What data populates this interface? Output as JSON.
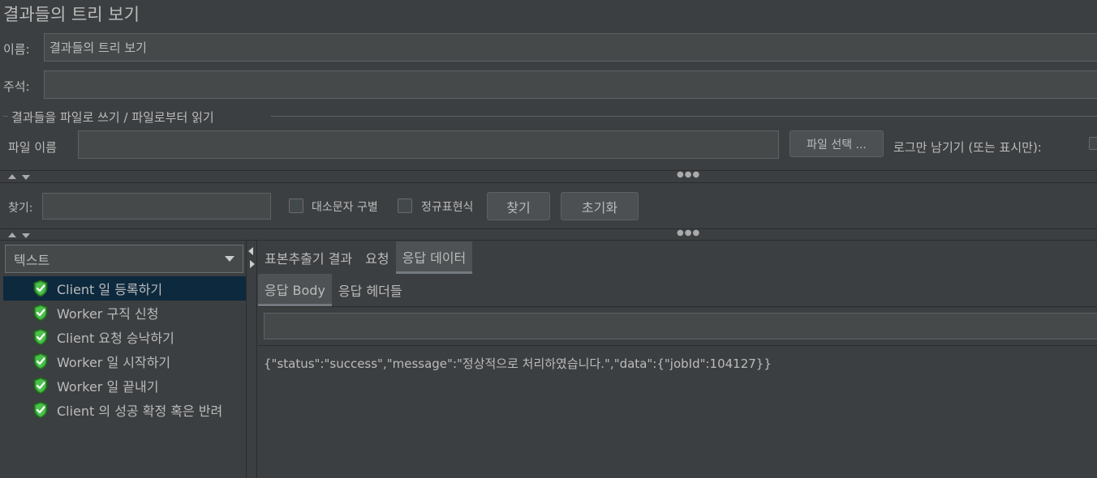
{
  "window": {
    "title": "결과들의 트리 보기"
  },
  "form": {
    "name_label": "이름:",
    "name_value": "결과들의 트리 보기",
    "comment_label": "주석:",
    "comment_value": "",
    "file_group_title": "결과들을 파일로 쓰기 / 파일로부터 읽기",
    "filename_label": "파일 이름",
    "filename_value": "",
    "browse_button": "파일 선택 ...",
    "log_only_label": "로그만 남기기 (또는 표시만):"
  },
  "search": {
    "label": "찾기:",
    "value": "",
    "case_sensitive_label": "대소문자 구별",
    "regex_label": "정규표현식",
    "find_button": "찾기",
    "reset_button": "초기화"
  },
  "renderer": {
    "selected": "텍스트"
  },
  "tree": {
    "items": [
      {
        "label": "Client 일 등록하기",
        "status": "success",
        "selected": true
      },
      {
        "label": "Worker 구직 신청",
        "status": "success",
        "selected": false
      },
      {
        "label": "Client 요청 승낙하기",
        "status": "success",
        "selected": false
      },
      {
        "label": "Worker 일 시작하기",
        "status": "success",
        "selected": false
      },
      {
        "label": "Worker 일 끝내기",
        "status": "success",
        "selected": false
      },
      {
        "label": "Client 의 성공 확정 혹은 반려",
        "status": "success",
        "selected": false
      }
    ]
  },
  "tabs": {
    "main": [
      "표본추출기 결과",
      "요청",
      "응답 데이터"
    ],
    "main_active": "응답 데이터",
    "sub": [
      "응답 Body",
      "응답 헤더들"
    ],
    "sub_active": "응답 Body"
  },
  "response": {
    "search_value": "",
    "body": "{\"status\":\"success\",\"message\":\"정상적으로 처리하였습니다.\",\"data\":{\"jobId\":104127}}"
  },
  "colors": {
    "background": "#3c3f41",
    "field": "#45494a",
    "selection": "#0d293e",
    "success_icon": "#3ea93e"
  }
}
